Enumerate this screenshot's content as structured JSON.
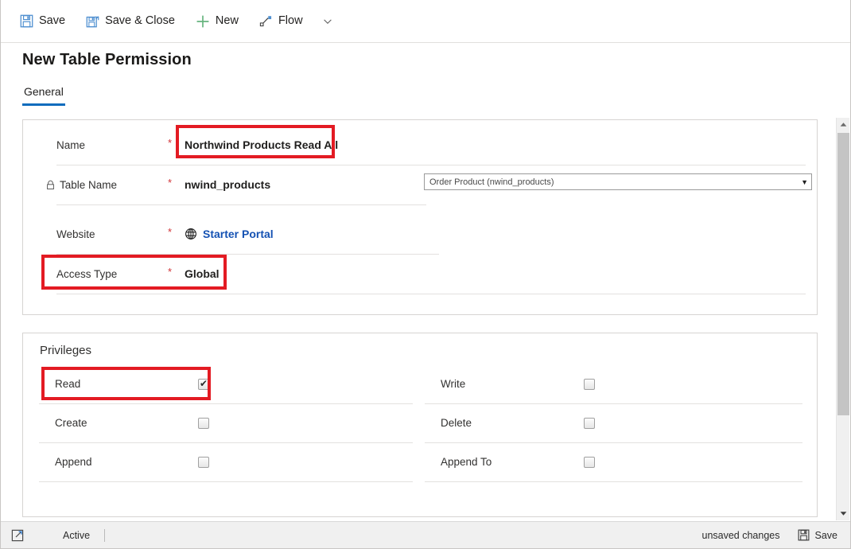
{
  "toolbar": {
    "items": [
      {
        "label": "Save",
        "icon": "save-floppy-icon"
      },
      {
        "label": "Save & Close",
        "icon": "save-and-close-icon"
      },
      {
        "label": "New",
        "icon": "plus-icon"
      },
      {
        "label": "Flow",
        "icon": "flow-icon"
      }
    ],
    "overflow_icon": "chevron-down-icon"
  },
  "header": {
    "title": "New Table Permission",
    "tabs": [
      {
        "label": "General",
        "selected": true
      }
    ]
  },
  "general": {
    "fields": [
      {
        "label": "Name",
        "required": "*",
        "value": "Northwind Products Read All",
        "locked": false,
        "highlighted": true
      },
      {
        "label": "Table Name",
        "required": "*",
        "value": "nwind_products",
        "locked": true,
        "highlighted": false
      },
      {
        "label": "Website",
        "required": "*",
        "value": "Starter Portal",
        "locked": false,
        "link": true,
        "icon": "globe-icon",
        "highlighted": false
      },
      {
        "label": "Access Type",
        "required": "*",
        "value": "Global",
        "locked": false,
        "highlighted": true
      }
    ],
    "table_dropdown": {
      "value": "Order Product (nwind_products)",
      "arrow_icon": "dropdown-arrow-icon"
    }
  },
  "privileges": {
    "title": "Privileges",
    "left_column": [
      {
        "label": "Read",
        "checked": true,
        "highlighted": true
      },
      {
        "label": "Create",
        "checked": false,
        "highlighted": false
      },
      {
        "label": "Append",
        "checked": false,
        "highlighted": false
      }
    ],
    "right_column": [
      {
        "label": "Write",
        "checked": false
      },
      {
        "label": "Delete",
        "checked": false
      },
      {
        "label": "Append To",
        "checked": false
      }
    ]
  },
  "statusbar": {
    "popout_icon": "open-in-new-window-icon",
    "state": "Active",
    "unsaved": "unsaved changes",
    "save_label": "Save",
    "save_icon": "save-floppy-icon"
  },
  "colors": {
    "accent": "#0f6cbd",
    "callout": "#e31b23",
    "required": "#d13438",
    "link": "#1552b3"
  },
  "checkmark_glyph": "✔"
}
